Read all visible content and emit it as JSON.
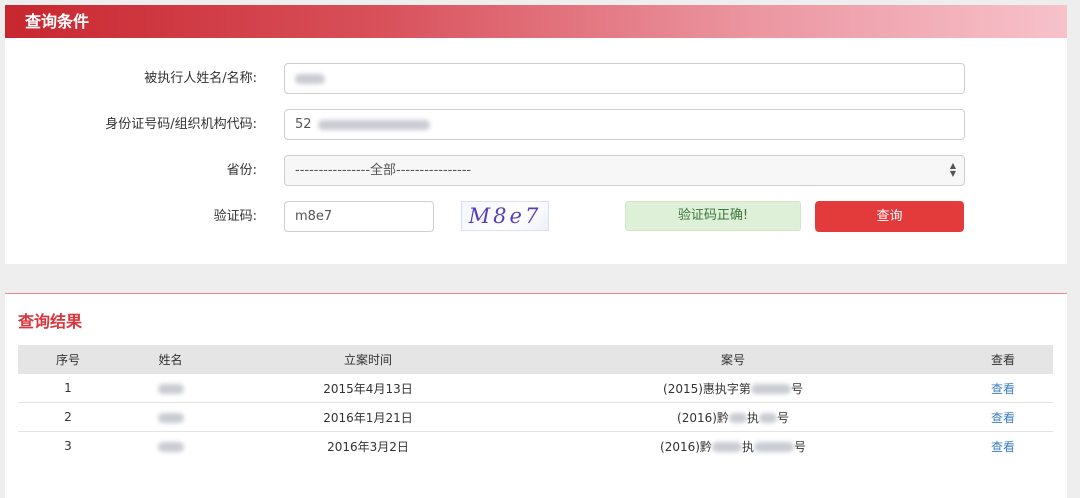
{
  "form_panel": {
    "title": "查询条件",
    "name_label": "被执行人姓名/名称:",
    "id_label": "身份证号码/组织机构代码:",
    "id_value_prefix": "52",
    "province_label": "省份:",
    "province_selected": "----------------全部----------------",
    "captcha_label": "验证码:",
    "captcha_input_value": "m8e7",
    "captcha_image_text": "M8e7",
    "verify_status": "验证码正确!",
    "query_button": "查询"
  },
  "results_panel": {
    "title": "查询结果",
    "columns": [
      "序号",
      "姓名",
      "立案时间",
      "案号",
      "查看"
    ],
    "rows": [
      {
        "index": "1",
        "date": "2015年4月13日",
        "case_prefix": "(2015)惠执字第",
        "case_suffix": "号",
        "view": "查看"
      },
      {
        "index": "2",
        "date": "2016年1月21日",
        "case_prefix": "(2016)黔",
        "case_mid": "执",
        "case_suffix": "号",
        "view": "查看"
      },
      {
        "index": "3",
        "date": "2016年3月2日",
        "case_prefix": "(2016)黔",
        "case_mid": "执",
        "case_suffix": "号",
        "view": "查看"
      }
    ]
  },
  "colors": {
    "header_red": "#c8272f",
    "button_red": "#e33b3b",
    "success_bg": "#dff0d8",
    "link_blue": "#3c7dc0"
  }
}
